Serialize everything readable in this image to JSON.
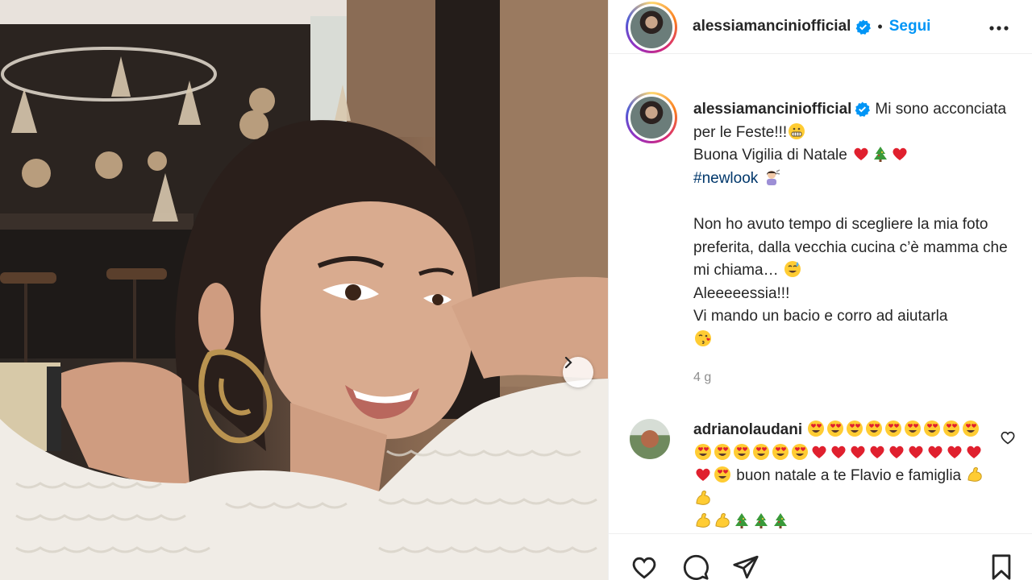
{
  "post": {
    "author": "alessiamanciniofficial",
    "follow_label": "Segui",
    "separator": "•"
  },
  "caption": {
    "username": "alessiamanciniofficial",
    "line1": "Mi sono acconciata per le Feste!!!",
    "line2": "Buona Vigilia di Natale",
    "hashtag": "#newlook",
    "line3": "Non ho avuto tempo di scegliere la mia foto preferita, dalla vecchia cucina c’è mamma che mi chiama…",
    "line4": "Aleeeeessia!!!",
    "line5": "Vi mando un bacio e corro ad aiutarla"
  },
  "time_ago": "4 g",
  "comment": {
    "username": "adrianolaudani",
    "text1": "buon natale a te Flavio e famiglia"
  },
  "colors": {
    "accent": "#0095f6",
    "hashtag": "#00376b",
    "muted": "#8e8e8e",
    "heart": "#ed4956"
  },
  "icons": [
    "verified-badge-icon",
    "more-options-icon",
    "next-arrow-icon",
    "like-heart-icon",
    "comment-icon",
    "share-icon",
    "save-bookmark-icon",
    "comment-like-icon"
  ]
}
